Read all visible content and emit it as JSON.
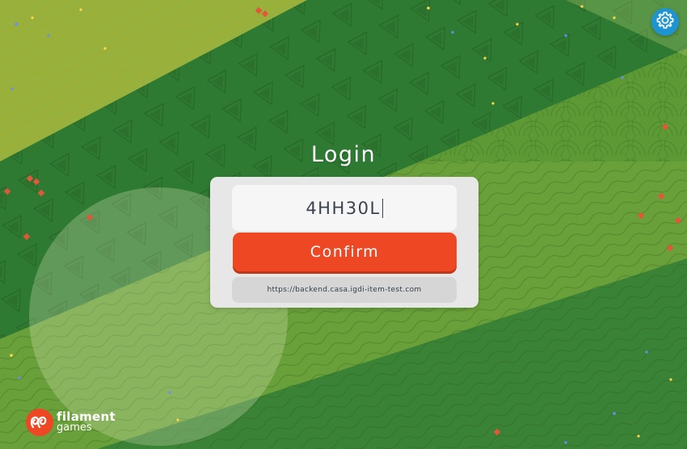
{
  "header": {
    "title": "Login",
    "settings_icon": "gear-icon"
  },
  "login": {
    "code_value": "4HH30L",
    "confirm_label": "Confirm",
    "server_url": "https://backend.casa.igdi-item-test.com"
  },
  "brand": {
    "name": "filament",
    "sub": "games",
    "logo_icon": "filament-logo-icon"
  },
  "colors": {
    "accent": "#ee4724",
    "settings": "#1e95d3",
    "panel": "#e7e7e7",
    "background_green": "#5e8f2c"
  }
}
